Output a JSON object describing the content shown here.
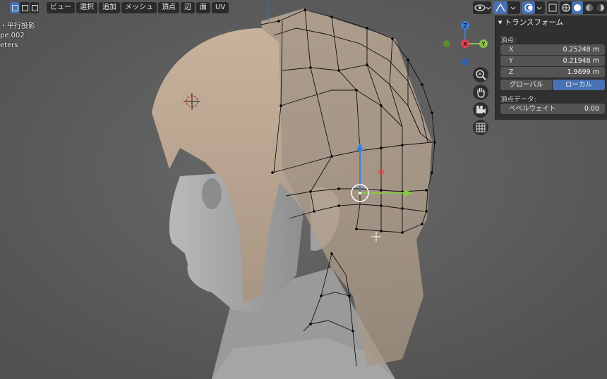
{
  "header": {
    "menus": [
      "ビュー",
      "選択",
      "追加",
      "メッシュ",
      "頂点",
      "辺",
      "面",
      "UV"
    ]
  },
  "overlay": {
    "view_name": "・平行投影",
    "object_name": "pe.002",
    "units": "eters"
  },
  "transform_panel": {
    "title": "トランスフォーム",
    "section_label": "頂点:",
    "x": {
      "label": "X",
      "value": "0.25248 m"
    },
    "y": {
      "label": "Y",
      "value": "0.21948 m"
    },
    "z": {
      "label": "Z",
      "value": "1.9699 m"
    },
    "global_label": "グローバル",
    "local_label": "ローカル",
    "vertex_data_label": "頂点データ:",
    "bevel_weight": {
      "label": "ベベルウェイト",
      "value": "0.00"
    }
  },
  "gizmo": {
    "z_label": "Z",
    "x_label": "X",
    "y_label": "Y"
  },
  "colors": {
    "accent": "#4772b3",
    "axis_x": "#e0434f",
    "axis_y": "#8bc34a",
    "axis_z": "#3c7ee0"
  }
}
